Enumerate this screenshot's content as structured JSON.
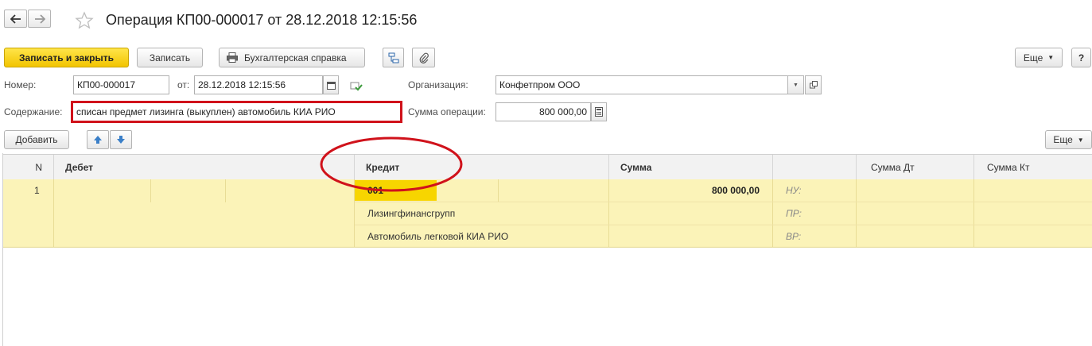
{
  "window": {
    "title": "Операция КП00-000017 от 28.12.2018 12:15:56"
  },
  "toolbar": {
    "save_close_label": "Записать и закрыть",
    "save_label": "Записать",
    "print_label": "Бухгалтерская справка",
    "more_label": "Еще",
    "help_label": "?"
  },
  "form": {
    "number_label": "Номер:",
    "number_value": "КП00-000017",
    "date_label": "от:",
    "date_value": "28.12.2018 12:15:56",
    "org_label": "Организация:",
    "org_value": "Конфетпром ООО",
    "content_label": "Содержание:",
    "content_value": "списан предмет лизинга (выкуплен) автомобиль КИА РИО",
    "sum_label": "Сумма операции:",
    "sum_value": "800 000,00"
  },
  "table_toolbar": {
    "add_label": "Добавить",
    "more_label": "Еще"
  },
  "table": {
    "columns": [
      "N",
      "Дебет",
      "Кредит",
      "Сумма",
      "",
      "Сумма Дт",
      "Сумма Кт"
    ],
    "row": {
      "n": "1",
      "credit_account": "001",
      "credit_subconto1": "Лизингфинансгрупп",
      "credit_subconto2": "Автомобиль легковой КИА РИО",
      "sum": "800 000,00",
      "nu": "НУ:",
      "pr": "ПР:",
      "vr": "ВР:"
    }
  },
  "colors": {
    "primary_button": "#f2c400",
    "row_highlight": "#fbf3b8",
    "selected_cell": "#f7d500",
    "annotation_red": "#d0121b"
  }
}
